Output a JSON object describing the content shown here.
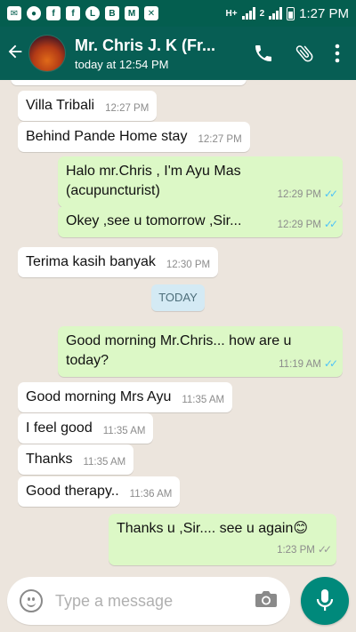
{
  "status_bar": {
    "time": "1:27 PM",
    "network": "H+",
    "signal2": "2"
  },
  "header": {
    "back_icon": "arrow-left-icon",
    "title": "Mr. Chris J. K (Fr...",
    "subtitle": "today at 12:54 PM"
  },
  "messages": [
    {
      "dir": "in",
      "text": "Villa Tribali",
      "time": "12:27 PM"
    },
    {
      "dir": "in",
      "text": "Behind Pande Home stay",
      "time": "12:27 PM"
    },
    {
      "dir": "out",
      "text": "Halo mr.Chris , I'm Ayu Mas (acupuncturist)",
      "time": "12:29 PM",
      "status": "read"
    },
    {
      "dir": "out",
      "text": "Okey ,see u tomorrow ,Sir...",
      "time": "12:29 PM",
      "status": "read"
    },
    {
      "dir": "in",
      "text": "Terima kasih banyak",
      "time": "12:30 PM"
    },
    {
      "dir": "out",
      "text": "Good morning Mr.Chris... how are u today?",
      "time": "11:19 AM",
      "status": "read"
    },
    {
      "dir": "in",
      "text": "Good morning Mrs Ayu",
      "time": "11:35 AM"
    },
    {
      "dir": "in",
      "text": "I feel good",
      "time": "11:35 AM"
    },
    {
      "dir": "in",
      "text": "Thanks",
      "time": "11:35 AM"
    },
    {
      "dir": "in",
      "text": "Good therapy..",
      "time": "11:36 AM"
    },
    {
      "dir": "out",
      "text": "Thanks u ,Sir.... see u again",
      "emoji": "😊",
      "time": "1:23 PM",
      "status": "sent"
    }
  ],
  "day_divider": "TODAY",
  "composer": {
    "placeholder": "Type a message"
  },
  "colors": {
    "header": "#075e54",
    "status_bar": "#045e4f",
    "outgoing": "#dcf8c6",
    "incoming": "#ffffff",
    "background": "#ece5dd",
    "mic": "#00897b",
    "read_ticks": "#4fc3f7"
  }
}
